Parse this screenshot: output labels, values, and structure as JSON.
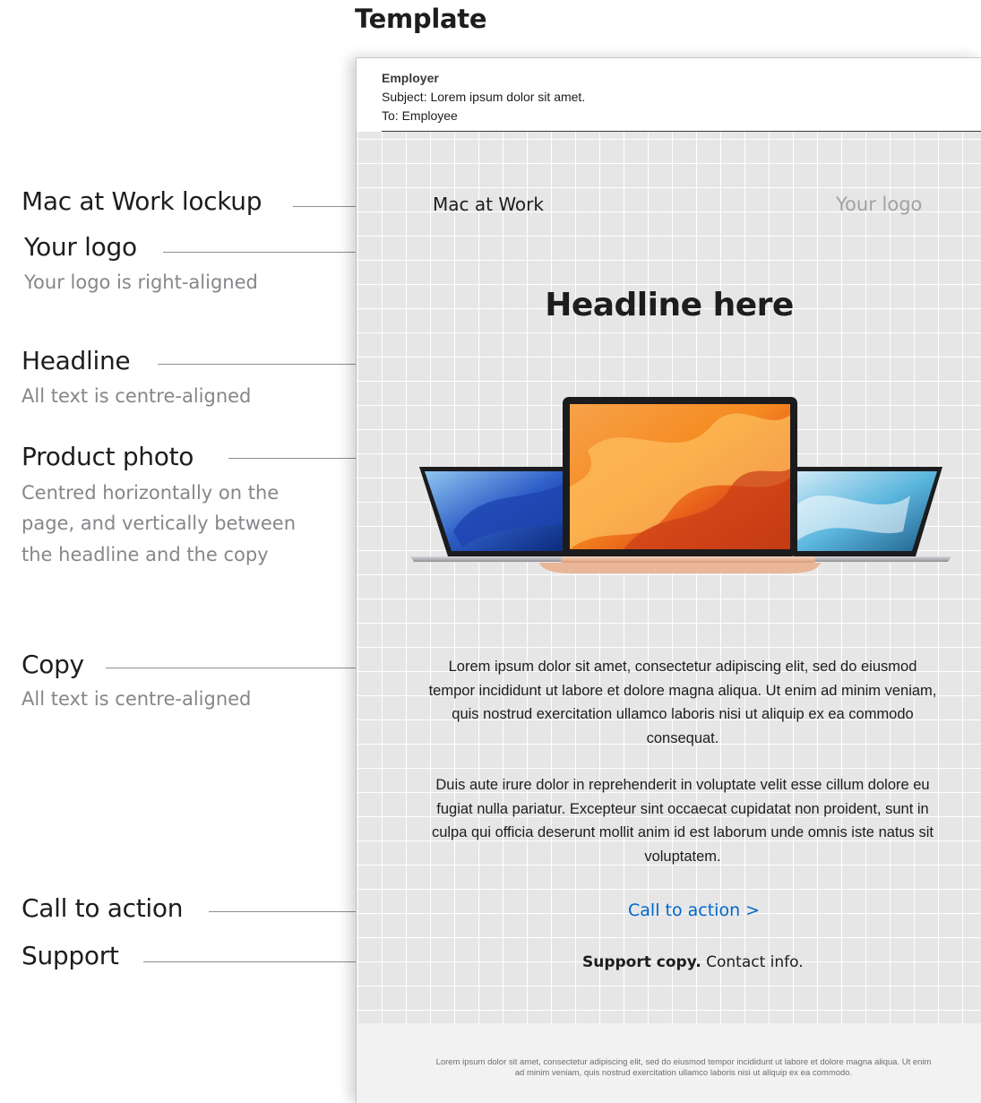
{
  "page": {
    "title": "Template"
  },
  "annotations": [
    {
      "label": "Mac at Work lockup",
      "description": ""
    },
    {
      "label": "Your logo",
      "description": "Your logo is right-aligned"
    },
    {
      "label": "Headline",
      "description": "All text is centre-aligned"
    },
    {
      "label": "Product photo",
      "description": [
        "Centred horizontally on the",
        "page, and vertically between",
        "the headline and the copy"
      ]
    },
    {
      "label": "Copy",
      "description": "All text is centre-aligned"
    },
    {
      "label": "Call to action",
      "description": ""
    },
    {
      "label": "Support",
      "description": ""
    }
  ],
  "email": {
    "from": "Employer",
    "subject": "Subject: Lorem ipsum dolor sit amet.",
    "to": "To: Employee",
    "lockup": "Mac at Work",
    "logo": "Your logo",
    "headline": "Headline here",
    "copy_paragraphs": [
      "Lorem ipsum dolor sit amet, consectetur adipiscing elit, sed do eiusmod tempor incididunt ut labore et dolore magna aliqua. Ut enim ad minim veniam, quis nostrud exercitation ullamco laboris nisi ut aliquip ex ea commodo consequat.",
      "Duis aute irure dolor in reprehenderit in voluptate velit esse cillum dolore eu fugiat nulla pariatur. Excepteur sint occaecat cupidatat non proident, sunt in culpa qui officia deserunt mollit anim id est laborum unde omnis iste natus sit voluptatem."
    ],
    "cta": "Call to action >",
    "support_bold": "Support copy.",
    "support_rest": " Contact info.",
    "footer": "Lorem ipsum dolor sit amet, consectetur adipiscing elit, sed do eiusmod tempor incididunt ut labore et dolore magna aliqua. Ut enim ad minim veniam, quis nostrud exercitation ullamco laboris nisi ut aliquip ex ea commodo."
  },
  "colors": {
    "link": "#0066cc",
    "grid_bg": "#e6e6e7",
    "muted": "#86868b"
  }
}
